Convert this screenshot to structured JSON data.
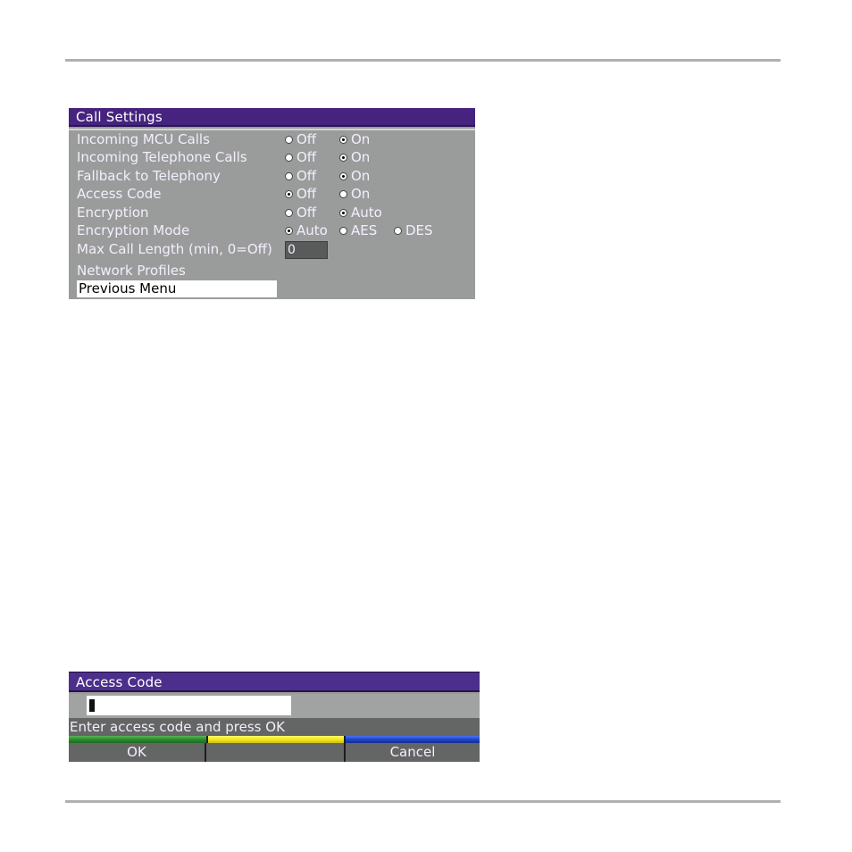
{
  "call_settings": {
    "title": "Call Settings",
    "rows": [
      {
        "label": "Incoming MCU Calls",
        "options": [
          {
            "label": "Off",
            "checked": false
          },
          {
            "label": "On",
            "checked": true
          }
        ]
      },
      {
        "label": "Incoming Telephone Calls",
        "options": [
          {
            "label": "Off",
            "checked": false
          },
          {
            "label": "On",
            "checked": true
          }
        ]
      },
      {
        "label": "Fallback to Telephony",
        "options": [
          {
            "label": "Off",
            "checked": false
          },
          {
            "label": "On",
            "checked": true
          }
        ]
      },
      {
        "label": "Access Code",
        "options": [
          {
            "label": "Off",
            "checked": true
          },
          {
            "label": "On",
            "checked": false
          }
        ]
      },
      {
        "label": "Encryption",
        "options": [
          {
            "label": "Off",
            "checked": false
          },
          {
            "label": "Auto",
            "checked": true
          }
        ]
      },
      {
        "label": "Encryption Mode",
        "options": [
          {
            "label": "Auto",
            "checked": true
          },
          {
            "label": "AES",
            "checked": false
          },
          {
            "label": "DES",
            "checked": false
          }
        ]
      }
    ],
    "max_call_length": {
      "label": "Max Call Length (min, 0=Off)",
      "value": "0"
    },
    "network_profiles": "Network Profiles",
    "previous_menu": "Previous Menu"
  },
  "access_code_dialog": {
    "title": "Access Code",
    "input_value": "",
    "hint": "Enter access code and press OK",
    "buttons": [
      {
        "label": "OK",
        "color": "#2e8a2e"
      },
      {
        "label": "",
        "color": "#f2e81c"
      },
      {
        "label": "Cancel",
        "color": "#1f45c8"
      }
    ]
  }
}
